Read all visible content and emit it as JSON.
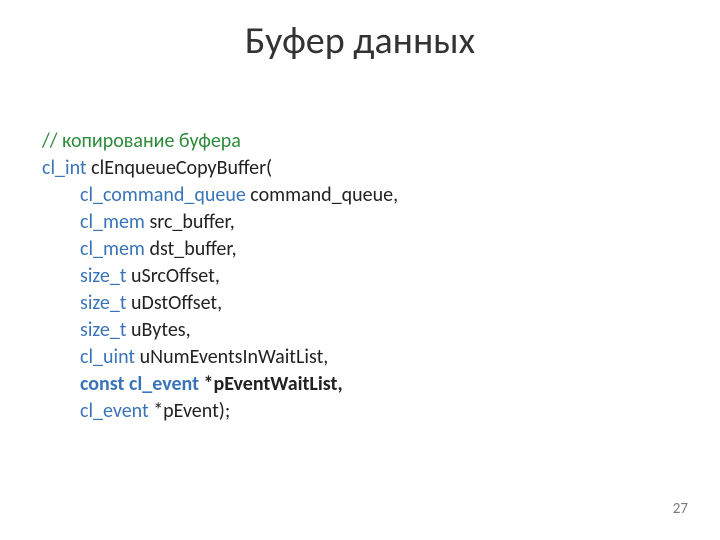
{
  "title": "Буфер данных",
  "code": {
    "comment": "// копирование буфера",
    "ret_type": "cl_int",
    "fn_name": " clEnqueueCopyBuffer(",
    "params": [
      {
        "type": "cl_command_queue",
        "name": " command_queue,"
      },
      {
        "type": "cl_mem",
        "name": " src_buffer,"
      },
      {
        "type": "cl_mem",
        "name": " dst_buffer,"
      },
      {
        "type": "size_t",
        "name": " uSrcOffset,"
      },
      {
        "type": "size_t",
        "name": " uDstOffset,"
      },
      {
        "type": "size_t",
        "name": " uBytes,"
      },
      {
        "type": "cl_uint",
        "name": " uNumEventsInWaitList,"
      }
    ],
    "bold_param": {
      "const": "const",
      "type": " cl_event ",
      "rest": "*pEventWaitList,"
    },
    "last_param": {
      "type": "cl_event",
      "name": " *pEvent);"
    }
  },
  "page_number": "27"
}
